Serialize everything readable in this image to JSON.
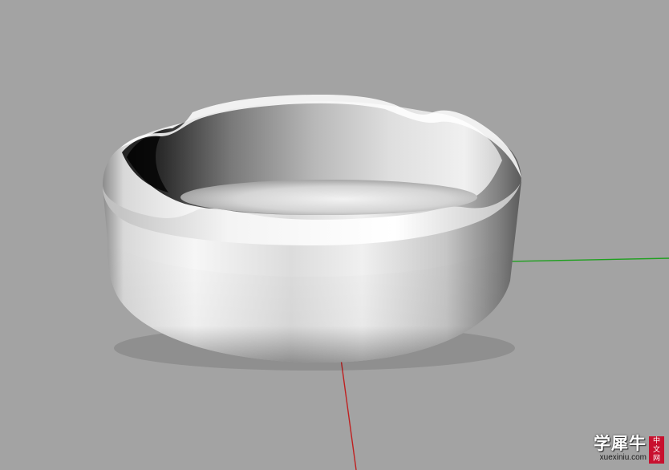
{
  "viewport": {
    "background": "#a3a3a3",
    "grid_color": "#8a8a8a",
    "grid_major_color": "#7a7a7a",
    "axis_x_color": "#1fa01f",
    "axis_y_color": "#c02020",
    "object": "ashtray-3d-model"
  },
  "watermark": {
    "title": "学犀牛",
    "url": "xuexiniu.com",
    "seal": [
      "中",
      "文",
      "网"
    ],
    "seal_color": "#c8102e"
  }
}
